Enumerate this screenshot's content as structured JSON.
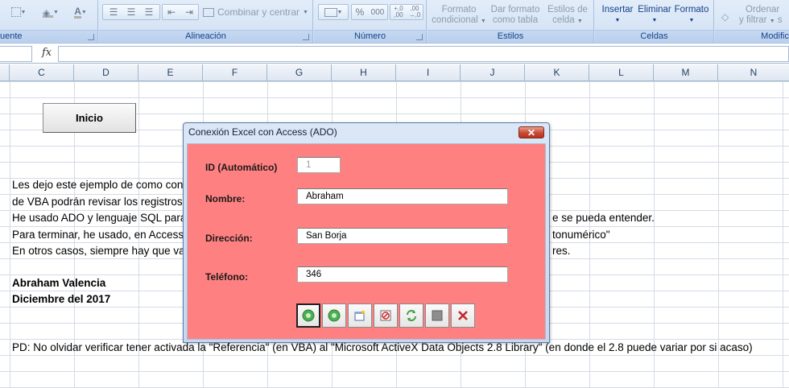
{
  "ribbon": {
    "font_group_label": "uente",
    "alignment_group_label": "Alineación",
    "merge_label": "Combinar y centrar",
    "number_group_label": "Número",
    "percent_label": "%",
    "thousands_label": "000",
    "inc_decimal_label": "+,0 ,00",
    "dec_decimal_label": ",00 →,0",
    "conditional_format_line1": "Formato",
    "conditional_format_line2": "condicional",
    "format_table_line1": "Dar formato",
    "format_table_line2": "como tabla",
    "cell_styles_line1": "Estilos de",
    "cell_styles_line2": "celda",
    "styles_group_label": "Estilos",
    "insert_label": "Insertar",
    "delete_label": "Eliminar",
    "format_label": "Formato",
    "cells_group_label": "Celdas",
    "sort_line1": "Ordenar",
    "sort_line2": "y filtrar",
    "editing_group_label": "Modific"
  },
  "formula_bar": {
    "fx": "fx",
    "name_box_value": "",
    "formula_value": ""
  },
  "columns": [
    "C",
    "D",
    "E",
    "F",
    "G",
    "H",
    "I",
    "J",
    "K",
    "L",
    "M",
    "N"
  ],
  "sheet": {
    "inicio_button": "Inicio",
    "lines": [
      "Les dejo este ejemplo de como con",
      "de VBA podrán revisar los registros",
      "He usado ADO y lenguaje SQL para",
      "Para terminar, he usado, en Access",
      "En otros casos, siempre hay que va"
    ],
    "lines_right": [
      "e se pueda entender.",
      "tonumérico\"",
      "res."
    ],
    "author": "Abraham Valencia",
    "date": "Diciembre del 2017",
    "footnote": "PD: No olvidar verificar tener activada la \"Referencia\" (en VBA) al \"Microsoft ActiveX Data Objects 2.8 Library\" (en donde el 2.8 puede variar por si acaso)"
  },
  "dialog": {
    "title": "Conexión Excel con Access (ADO)",
    "close_glyph": "✕",
    "body_color": "#ff8080",
    "fields": [
      {
        "label": "ID (Automático)",
        "value": "1",
        "disabled": true
      },
      {
        "label": "Nombre:",
        "value": "Abraham"
      },
      {
        "label": "Dirección:",
        "value": "San Borja"
      },
      {
        "label": "Teléfono:",
        "value": "346"
      }
    ],
    "toolbar": [
      {
        "icon": "first-record-icon"
      },
      {
        "icon": "next-record-icon"
      },
      {
        "icon": "new-record-icon"
      },
      {
        "icon": "delete-record-icon"
      },
      {
        "icon": "refresh-icon"
      },
      {
        "icon": "save-icon"
      },
      {
        "icon": "close-x-icon"
      }
    ]
  }
}
